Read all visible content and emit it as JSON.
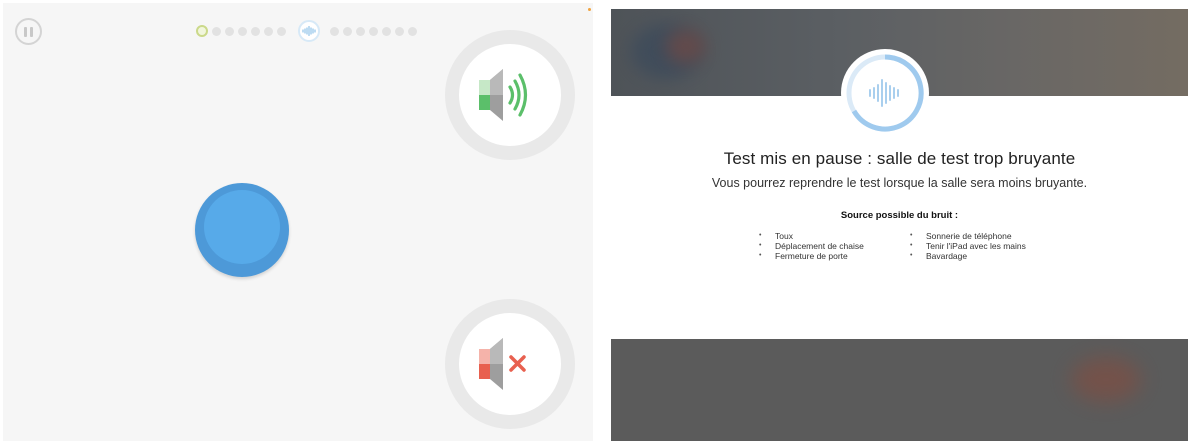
{
  "left_panel": {
    "progress": {
      "dots_before": 7,
      "dots_after": 7,
      "current_index": 0
    },
    "buttons": {
      "sound_on": {
        "icon": "speaker-sound-icon"
      },
      "sound_off": {
        "icon": "speaker-muted-icon"
      },
      "respond": {
        "icon": "response-button"
      }
    },
    "colors": {
      "accent_blue": "#57aae9",
      "sound_green": "#5bbf6a",
      "mute_red": "#e8604f"
    }
  },
  "right_panel": {
    "title": "Test mis en pause : salle de test trop bruyante",
    "subtitle": "Vous pourrez reprendre le test lorsque la salle sera moins bruyante.",
    "sources_title": "Source possible du bruit :",
    "sources_col1": [
      "Toux",
      "Déplacement de chaise",
      "Fermeture de porte"
    ],
    "sources_col2": [
      "Sonnerie de téléphone",
      "Tenir l'iPad avec les mains",
      "Bavardage"
    ],
    "badge_icon": "noise-waveform-icon"
  }
}
